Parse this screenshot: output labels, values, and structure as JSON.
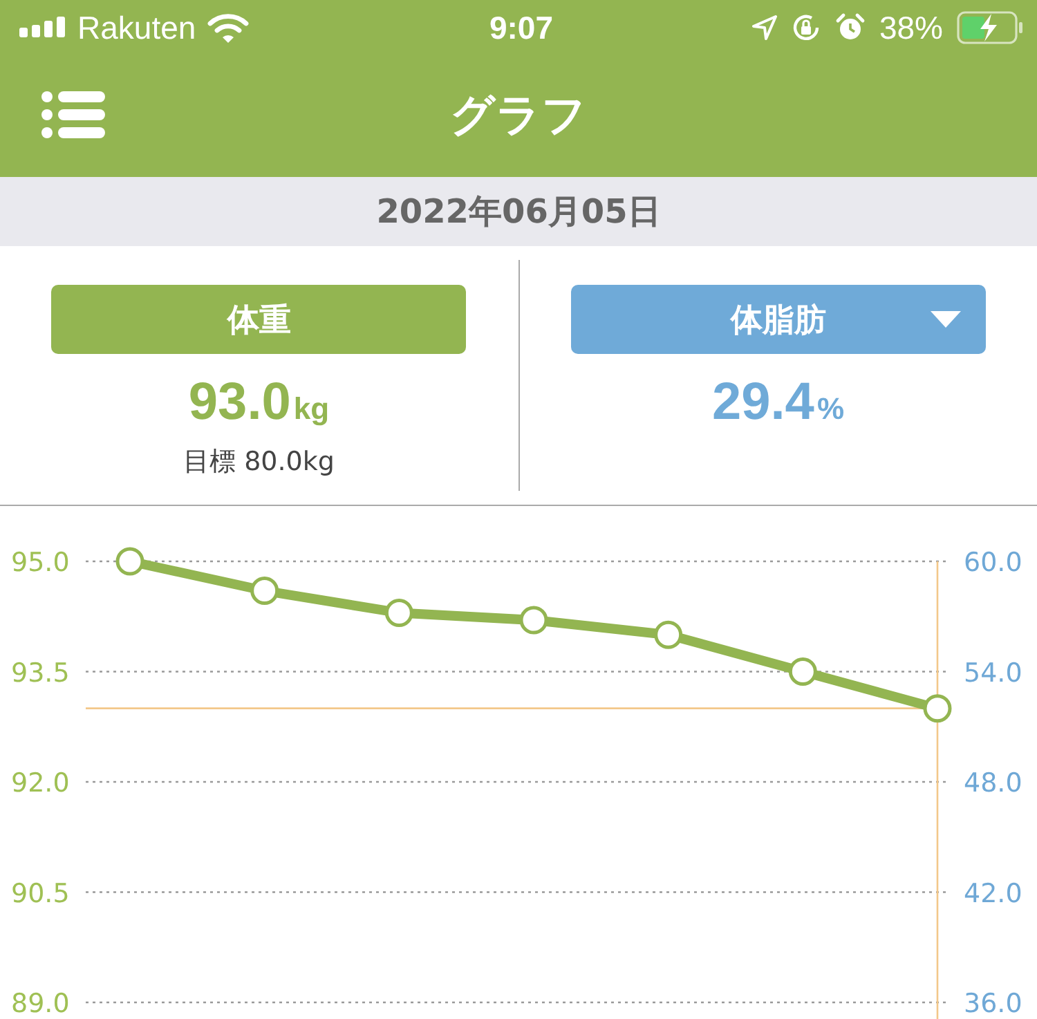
{
  "status_bar": {
    "carrier": "Rakuten",
    "time": "9:07",
    "battery": "38%"
  },
  "nav_bar": {
    "title": "グラフ"
  },
  "date": "2022年06月05日",
  "metrics": [
    {
      "kind": "fixed",
      "label": "体重",
      "color": "#93b551",
      "value": "93.0",
      "unit": "kg",
      "target": "目標 80.0kg"
    },
    {
      "kind": "dropdown",
      "label": "体脂肪",
      "color": "#6faad8",
      "value": "29.4",
      "unit": "%"
    }
  ],
  "chart": {
    "right_axis_labels": [
      "60.0",
      "54.0",
      "48.0",
      "42.0",
      "36.0"
    ],
    "chart_data": {
      "type": "line",
      "grid": true,
      "ylim": [
        89,
        95
      ],
      "yticks": [
        {
          "value": 95,
          "label": "95.0"
        },
        {
          "value": 93.5,
          "label": "93.5"
        },
        {
          "value": 92,
          "label": "92.0"
        },
        {
          "value": 90.5,
          "label": "90.5"
        },
        {
          "value": 89,
          "label": "89.0"
        }
      ],
      "series": [
        {
          "color": "#93b551",
          "marker": "circle",
          "values": [
            95.0,
            94.6,
            94.3,
            94.2,
            94.0,
            93.5,
            93.0
          ]
        }
      ],
      "ref_lines": [
        {
          "axis": "y",
          "value": 93.0
        }
      ]
    }
  }
}
